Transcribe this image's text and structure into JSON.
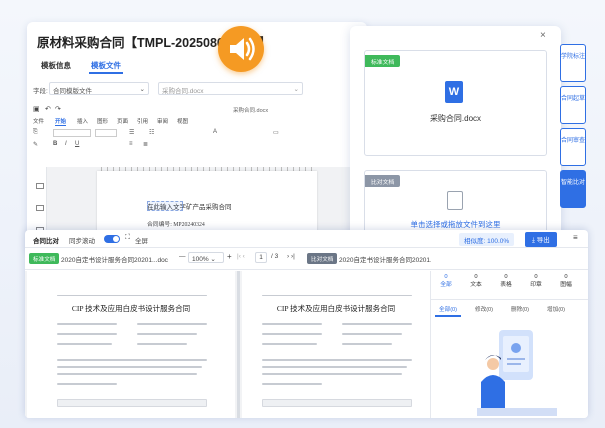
{
  "back": {
    "title": "原材料采购合同【TMPL-202508000010】",
    "tab_info": "模板信息",
    "tab_file": "模板文件",
    "field_label": "字段:",
    "field_select": "合同模版文件",
    "field_file": "采购合同.docx",
    "doc_title": "采购合同.docx",
    "menu": [
      "文件",
      "开始",
      "插入",
      "图形",
      "页面",
      "引用",
      "审阅",
      "视图"
    ],
    "doc_text1": "在此输入文字矿产品采购合同",
    "doc_text2": "合同编号: MP20240324"
  },
  "rpanel": {
    "close": "×",
    "std_tag": "标准文档",
    "std_file": "采购合同.docx",
    "cmp_tag": "比对文档",
    "cmp_hint": "单击选择或拖放文件到这里"
  },
  "sidebtns": [
    "学院标注",
    "合同起草",
    "合同审查",
    "智能比对"
  ],
  "compare": {
    "title": "合同比对",
    "sync_label": "同步滚动",
    "fullscreen": "全屏",
    "similarity": "相似度: 100.0%",
    "export": "导出",
    "menu_icon": "≡",
    "std_tag": "标准文档",
    "std_file": "2020自定书设计服务合同20201...doc",
    "zoom": "100%",
    "page_cur": "1",
    "page_total": "/ 3",
    "cmp_tag": "比对文档",
    "cmp_file": "2020自定书设计服务合同20201...doc",
    "stats": [
      {
        "num": "0",
        "label": "全部"
      },
      {
        "num": "0",
        "label": "文本"
      },
      {
        "num": "0",
        "label": "表格"
      },
      {
        "num": "0",
        "label": "印章"
      },
      {
        "num": "0",
        "label": "图幅"
      }
    ],
    "filters": [
      "全部(0)",
      "修改(0)",
      "删除(0)",
      "增加(0)"
    ],
    "doc_title": "CIP 技术及应用白皮书设计服务合同"
  },
  "colors": {
    "accent": "#2f6fe4",
    "green": "#3fb95b",
    "orange": "#f59a23",
    "teal": "#1c9d83"
  }
}
